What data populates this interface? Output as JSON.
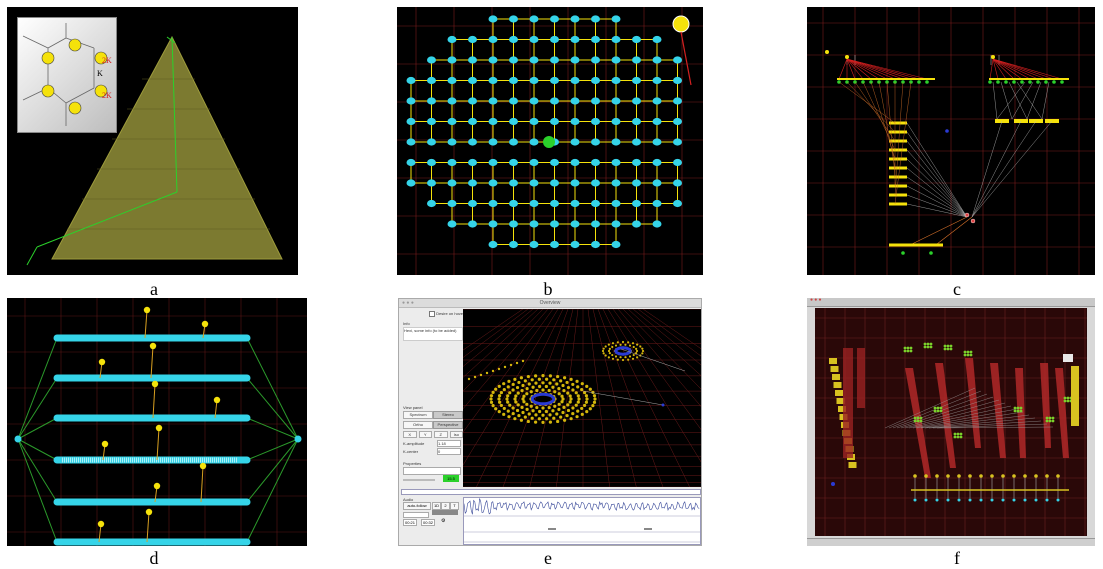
{
  "figure": {
    "panels": [
      {
        "id": "a",
        "caption": "a",
        "inset_labels": {
          "k": "K",
          "two_k_top": "2K",
          "two_k_bottom": "2K"
        }
      },
      {
        "id": "b",
        "caption": "b"
      },
      {
        "id": "c",
        "caption": "c"
      },
      {
        "id": "d",
        "caption": "d"
      },
      {
        "id": "e",
        "caption": "e",
        "window_title": "Overview",
        "checkbox_label": "Desire on hover",
        "info_header": "Info",
        "info_text": "Hexi, some info (to be added)",
        "view_group": "View panel",
        "btn_spectrum": "Spectrum",
        "btn_stereo": "Stereo",
        "btn_ortho": "Ortho",
        "btn_perspective": "Perspective",
        "axis_buttons": [
          "X",
          "Y",
          "Z",
          "Iso"
        ],
        "amplitude_label": "K-amplitude",
        "amplitude_value": "1.18",
        "k_center_label": "K-center",
        "k_center_value": "0",
        "props_header": "Properties",
        "green_value": "15.5",
        "audio_header": "Audio",
        "audio_button": "auto-follow",
        "audio_small": [
          "1D",
          "2",
          "T"
        ],
        "time_a": "00:21",
        "time_b": "00:32"
      },
      {
        "id": "f",
        "caption": "f"
      }
    ],
    "colors": {
      "black": "#000000",
      "grid": "#7a1d1d",
      "cyan": "#35d4e8",
      "yellow": "#f5e20b",
      "green": "#2bd12b",
      "olive": "#8b8b2a",
      "red": "#d42020",
      "blue": "#2a3ad4"
    }
  }
}
